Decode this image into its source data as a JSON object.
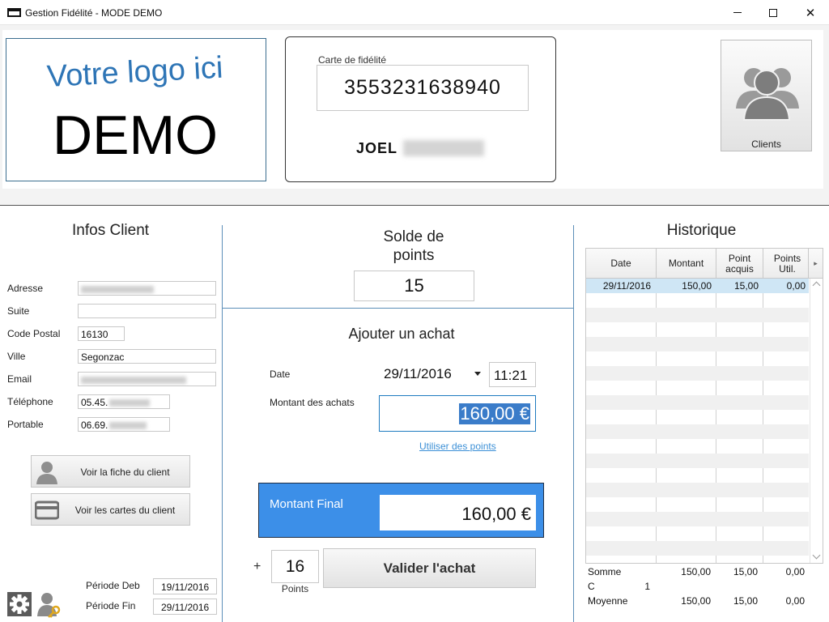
{
  "window": {
    "title": "Gestion Fidélité - MODE DEMO",
    "minimize": "—",
    "maximize": "☐",
    "close": "✕"
  },
  "logo": {
    "line1": "Votre logo ici",
    "line2": "DEMO"
  },
  "card": {
    "label": "Carte de fidélité",
    "number": "3553231638940",
    "first_name": "JOEL"
  },
  "clients_button": {
    "label": "Clients",
    "icon": "users-group-icon"
  },
  "infos": {
    "title": "Infos Client",
    "fields": [
      {
        "label": "Adresse",
        "value": ""
      },
      {
        "label": "Suite",
        "value": ""
      },
      {
        "label": "Code Postal",
        "value": "16130"
      },
      {
        "label": "Ville",
        "value": "Segonzac"
      },
      {
        "label": "Email",
        "value": ""
      },
      {
        "label": "Téléphone",
        "value": "05.45."
      },
      {
        "label": "Portable",
        "value": "06.69."
      }
    ],
    "btn_fiche": "Voir la fiche du client",
    "btn_cartes": "Voir les cartes du client",
    "periode_deb_label": "Période Deb",
    "periode_deb": "19/11/2016",
    "periode_fin_label": "Période Fin",
    "periode_fin": "29/11/2016"
  },
  "solde": {
    "title_line1": "Solde de",
    "title_line2": "points",
    "value": "15"
  },
  "achat": {
    "title": "Ajouter un achat",
    "date_label": "Date",
    "date": "29/11/2016",
    "time": "11:21",
    "montant_label": "Montant des achats",
    "montant": "160,00 €",
    "use_points_link": "Utiliser des points",
    "final_label": "Montant Final",
    "final_value": "160,00 €",
    "plus": "+",
    "points_earned": "16",
    "points_label": "Points",
    "validate": "Valider l'achat"
  },
  "historique": {
    "title": "Historique",
    "columns": [
      "Date",
      "Montant",
      "Point acquis",
      "Points Util."
    ],
    "rows": [
      {
        "date": "29/11/2016",
        "montant": "150,00",
        "acquis": "15,00",
        "util": "0,00"
      }
    ],
    "totals": {
      "somme_label": "Somme",
      "somme": [
        "150,00",
        "15,00",
        "0,00"
      ],
      "count_label": "C",
      "count": "1",
      "moyenne_label": "Moyenne",
      "moyenne": [
        "150,00",
        "15,00",
        "0,00"
      ]
    }
  },
  "colors": {
    "accent": "#3c8fe8",
    "selection": "#3a7cc9",
    "link": "#3b8fd6",
    "separator": "#5b8eb8"
  }
}
